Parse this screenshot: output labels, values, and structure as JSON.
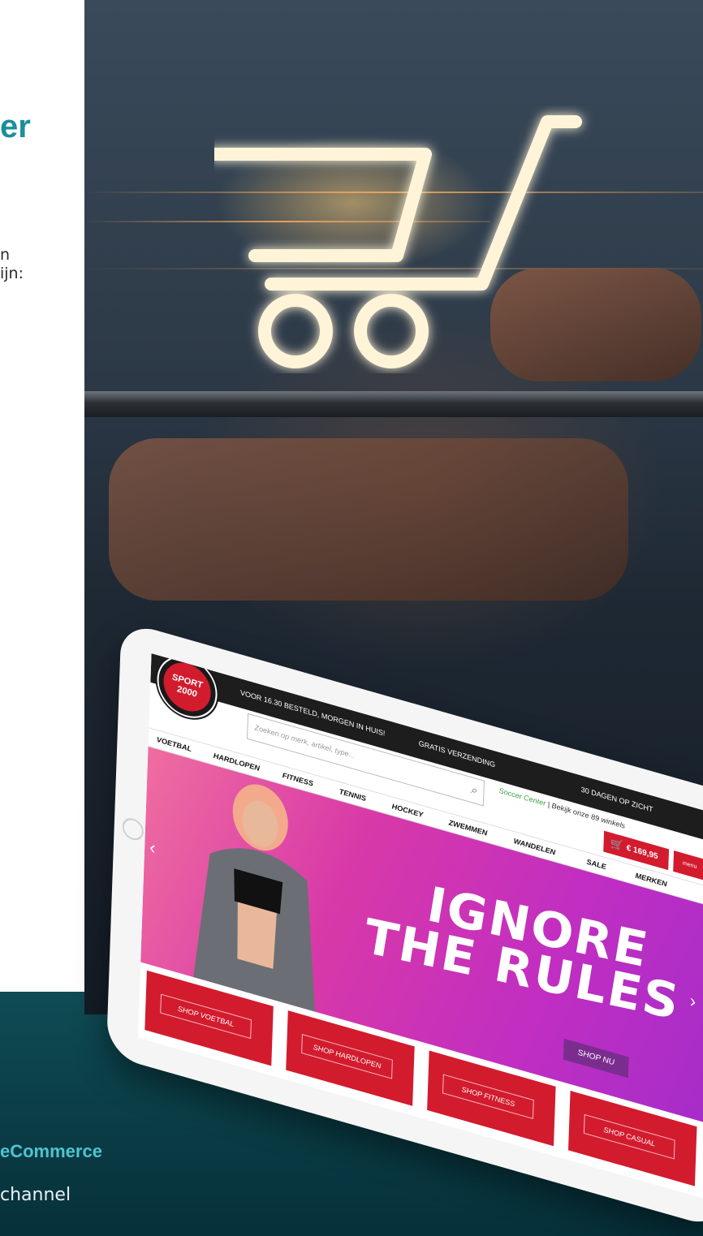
{
  "left_column": {
    "title_fragment": "er",
    "intro_line_1": "n",
    "intro_line_2": "ijn:"
  },
  "footer": {
    "heading": "eCommerce",
    "subtext": "channel"
  },
  "tablet_site": {
    "logo_text": "SPORT 2000",
    "topbar": {
      "delivery": "VOOR 16.30 BESTELD, MORGEN IN HUIS!",
      "shipping": "GRATIS VERZENDING",
      "returns": "30 DAGEN OP ZICHT"
    },
    "search_placeholder": "Zoeken op merk, artikel, type...",
    "subnav": {
      "soccer": "Soccer Center",
      "separator": "|",
      "stores": "Bekijk onze 89 winkels"
    },
    "cart_amount": "€ 169,95",
    "menu_label": "menu",
    "nav_items": [
      "VOETBAL",
      "HARDLOPEN",
      "FITNESS",
      "TENNIS",
      "HOCKEY",
      "ZWEMMEN",
      "WANDELEN",
      "SALE",
      "MERKEN"
    ],
    "banner": {
      "line_1": "IGNORE",
      "line_2": "THE RULES",
      "cta": "SHOP NU"
    },
    "tiles": [
      "SHOP VOETBAL",
      "SHOP HARDLOPEN",
      "SHOP FITNESS",
      "SHOP CASUAL"
    ]
  },
  "icons": {
    "cart": "shopping-cart-icon",
    "search": "search-icon",
    "menu": "menu-icon"
  },
  "colors": {
    "accent_teal": "#1a8f9c",
    "brand_red": "#d31b2e",
    "banner_magenta": "#c02ec2",
    "footer_band": "#0a3b44"
  }
}
